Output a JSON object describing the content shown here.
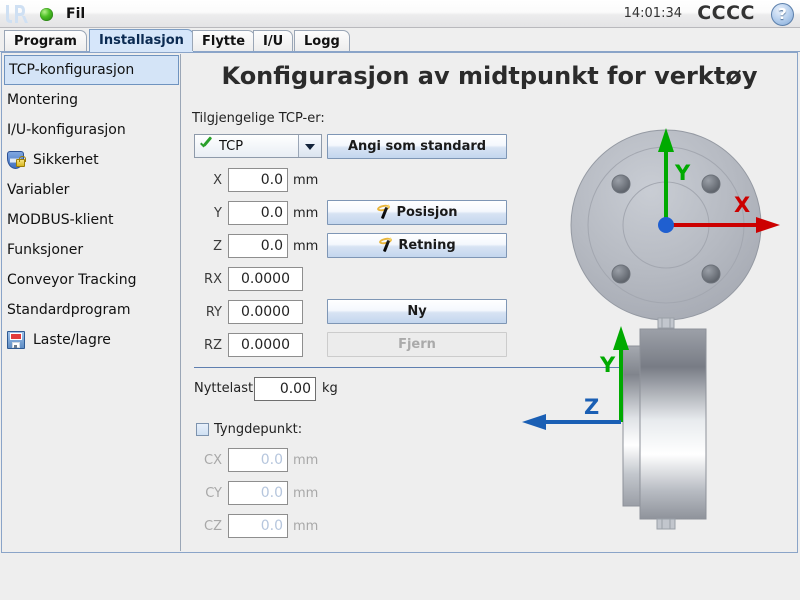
{
  "titlebar": {
    "logo_alt": "ur-logo",
    "file_menu": "Fil",
    "clock": "14:01:34",
    "robot_name": "CCCC",
    "help_label": "?"
  },
  "tabs": [
    {
      "label": "Program",
      "selected": false
    },
    {
      "label": "Installasjon",
      "selected": true
    },
    {
      "label": "Flytte",
      "selected": false
    },
    {
      "label": "I/U",
      "selected": false
    },
    {
      "label": "Logg",
      "selected": false
    }
  ],
  "sidebar": {
    "items": [
      {
        "label": "TCP-konfigurasjon",
        "icon": null,
        "selected": true
      },
      {
        "label": "Montering",
        "icon": null,
        "selected": false
      },
      {
        "label": "I/U-konfigurasjon",
        "icon": null,
        "selected": false
      },
      {
        "label": "Sikkerhet",
        "icon": "shield-lock-icon",
        "selected": false
      },
      {
        "label": "Variabler",
        "icon": null,
        "selected": false
      },
      {
        "label": "MODBUS-klient",
        "icon": null,
        "selected": false
      },
      {
        "label": "Funksjoner",
        "icon": null,
        "selected": false
      },
      {
        "label": "Conveyor Tracking",
        "icon": null,
        "selected": false
      },
      {
        "label": "Standardprogram",
        "icon": null,
        "selected": false
      },
      {
        "label": "Laste/lagre",
        "icon": "floppy-disk-icon",
        "selected": false
      }
    ]
  },
  "main": {
    "title": "Konfigurasjon av midtpunkt for verktøy",
    "available_label": "Tilgjengelige TCP-er:",
    "tcp_select": {
      "value": "TCP",
      "icon": "green-check-icon",
      "options": [
        "TCP"
      ]
    },
    "buttons": {
      "set_default": "Angi som standard",
      "position": "Posisjon",
      "orientation": "Retning",
      "new": "Ny",
      "remove": "Fjern",
      "remove_disabled": true
    },
    "pose_fields": [
      {
        "label": "X",
        "value": "0.0",
        "unit": "mm",
        "wide": false
      },
      {
        "label": "Y",
        "value": "0.0",
        "unit": "mm",
        "wide": false
      },
      {
        "label": "Z",
        "value": "0.0",
        "unit": "mm",
        "wide": false
      },
      {
        "label": "RX",
        "value": "0.0000",
        "unit": "",
        "wide": true
      },
      {
        "label": "RY",
        "value": "0.0000",
        "unit": "",
        "wide": true
      },
      {
        "label": "RZ",
        "value": "0.0000",
        "unit": "",
        "wide": true
      }
    ],
    "payload": {
      "label": "Nyttelast:",
      "value": "0.00",
      "unit": "kg"
    },
    "center_of_gravity": {
      "label": "Tyngdepunkt:",
      "checked": false,
      "fields": [
        {
          "label": "CX",
          "value": "0.0",
          "unit": "mm"
        },
        {
          "label": "CY",
          "value": "0.0",
          "unit": "mm"
        },
        {
          "label": "CZ",
          "value": "0.0",
          "unit": "mm"
        }
      ]
    },
    "diagram": {
      "front_view": {
        "axis_x_label": "X",
        "axis_y_label": "Y",
        "axis_x_color": "#cc0000",
        "axis_y_color": "#00aa00",
        "origin_color": "#1f5fd0"
      },
      "side_view": {
        "axis_y_label": "Y",
        "axis_z_label": "Z",
        "axis_y_color": "#00aa00",
        "axis_z_color": "#1a5fb4"
      }
    }
  },
  "colors": {
    "accent": "#d4e4f7",
    "tab_selected": "#d6e6fa",
    "panel_border": "#8aa4c8",
    "background": "#eeeeee",
    "divider": "#5f7fb0"
  }
}
